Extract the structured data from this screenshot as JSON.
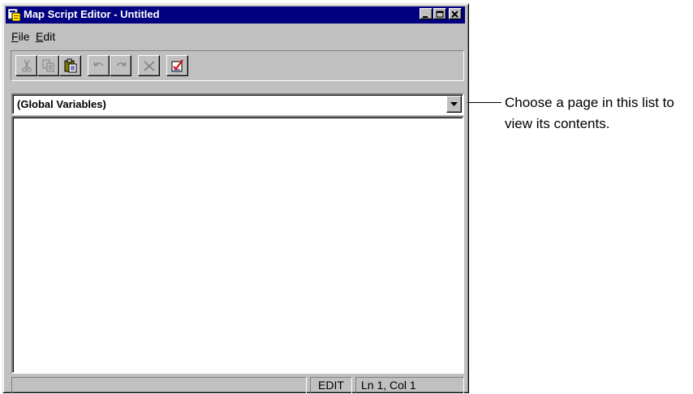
{
  "window": {
    "title": "Map Script Editor - Untitled",
    "icon": "map-script-app-icon",
    "controls": [
      "minimize-icon",
      "maximize-icon",
      "close-icon"
    ]
  },
  "menu": {
    "file": {
      "mnemonic": "F",
      "rest": "ile"
    },
    "edit": {
      "mnemonic": "E",
      "rest": "dit"
    }
  },
  "toolbar": {
    "buttons": [
      {
        "icon": "cut-icon",
        "enabled": false
      },
      {
        "icon": "copy-icon",
        "enabled": false
      },
      {
        "icon": "paste-icon",
        "enabled": true
      },
      {
        "icon": "undo-icon",
        "enabled": false
      },
      {
        "icon": "redo-icon",
        "enabled": false
      },
      {
        "icon": "delete-icon",
        "enabled": false
      },
      {
        "icon": "check-syntax-icon",
        "enabled": true
      }
    ]
  },
  "page_selector": {
    "selected": "(Global Variables)"
  },
  "editor": {
    "content": ""
  },
  "status": {
    "message": "",
    "mode": "EDIT",
    "position": "Ln 1, Col 1"
  },
  "callout": {
    "text": "Choose a page in this list to view its contents."
  },
  "colors": {
    "titlebar": "#000080",
    "face": "#c0c0c0",
    "disabled_icon": "#808080"
  }
}
